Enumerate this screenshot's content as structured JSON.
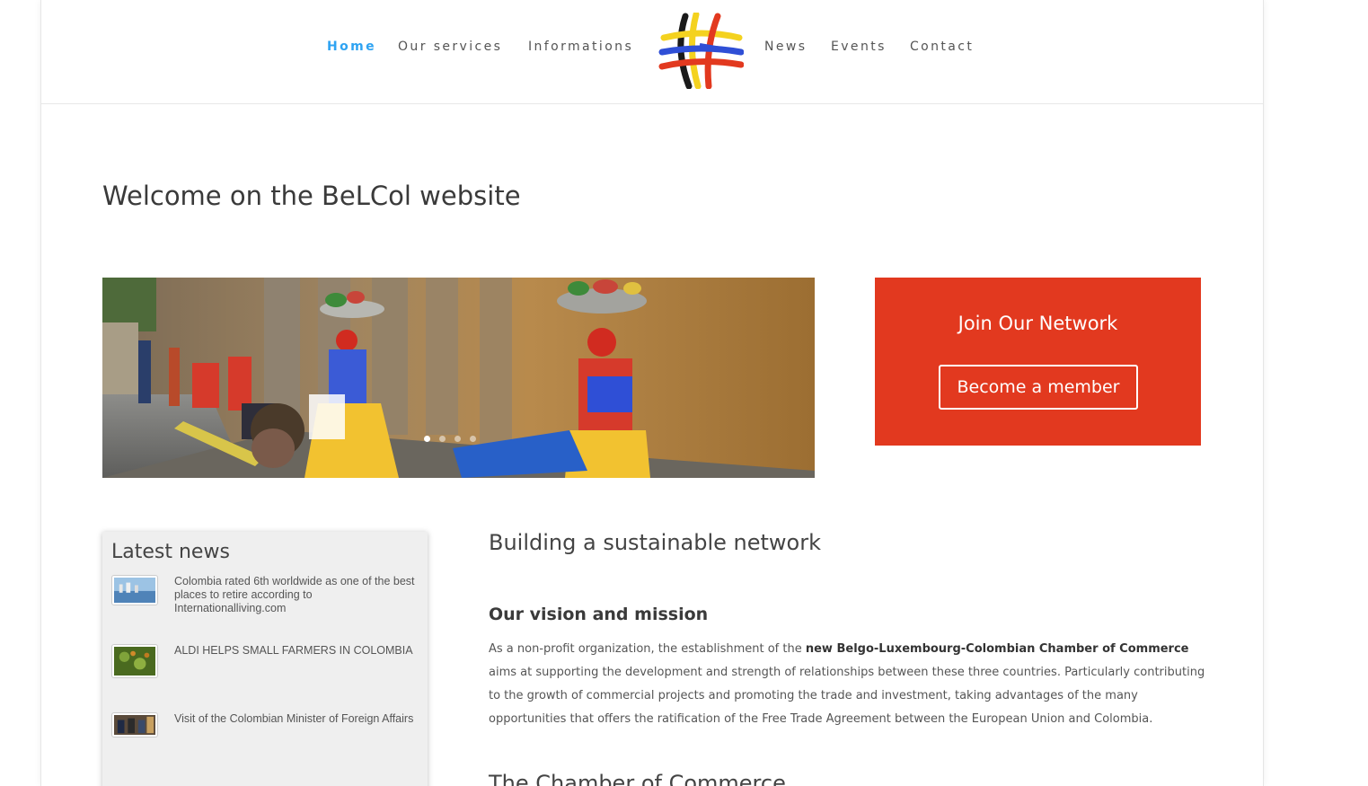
{
  "nav": {
    "items": [
      {
        "label": "Home",
        "active": true
      },
      {
        "label": "Our services"
      },
      {
        "label": "Informations"
      },
      {
        "label": "News"
      },
      {
        "label": "Events"
      },
      {
        "label": "Contact"
      }
    ],
    "accent_color": "#2ea3f2"
  },
  "page": {
    "title": "Welcome on the BeLCol website"
  },
  "slider": {
    "slide_count": 4,
    "active_slide": 1
  },
  "cta": {
    "title": "Join Our Network",
    "button_label": "Become a member",
    "background_color": "#e2391f"
  },
  "latest_news": {
    "title": "Latest news",
    "items": [
      {
        "text": "Colombia rated 6th worldwide as one of the best places to retire according to Internationalliving.com"
      },
      {
        "text": "ALDI HELPS SMALL FARMERS IN COLOMBIA"
      },
      {
        "text": "Visit of the Colombian Minister of Foreign Affairs"
      }
    ]
  },
  "content": {
    "heading": "Building a sustainable network",
    "subheading": "Our vision and mission",
    "para_part1": "As a non-profit organization, the establishment of the ",
    "para_bold": "new Belgo-Luxembourg-Colombian Chamber of Commerce",
    "para_part2": " aims at supporting the development and strength of relationships between these three countries. Particularly contributing to the growth of commercial projects and promoting the trade and investment, taking advantages of the many opportunities that offers the ratification of the Free Trade Agreement between the European Union and Colombia.",
    "next_heading": "The Chamber of Commerce"
  }
}
